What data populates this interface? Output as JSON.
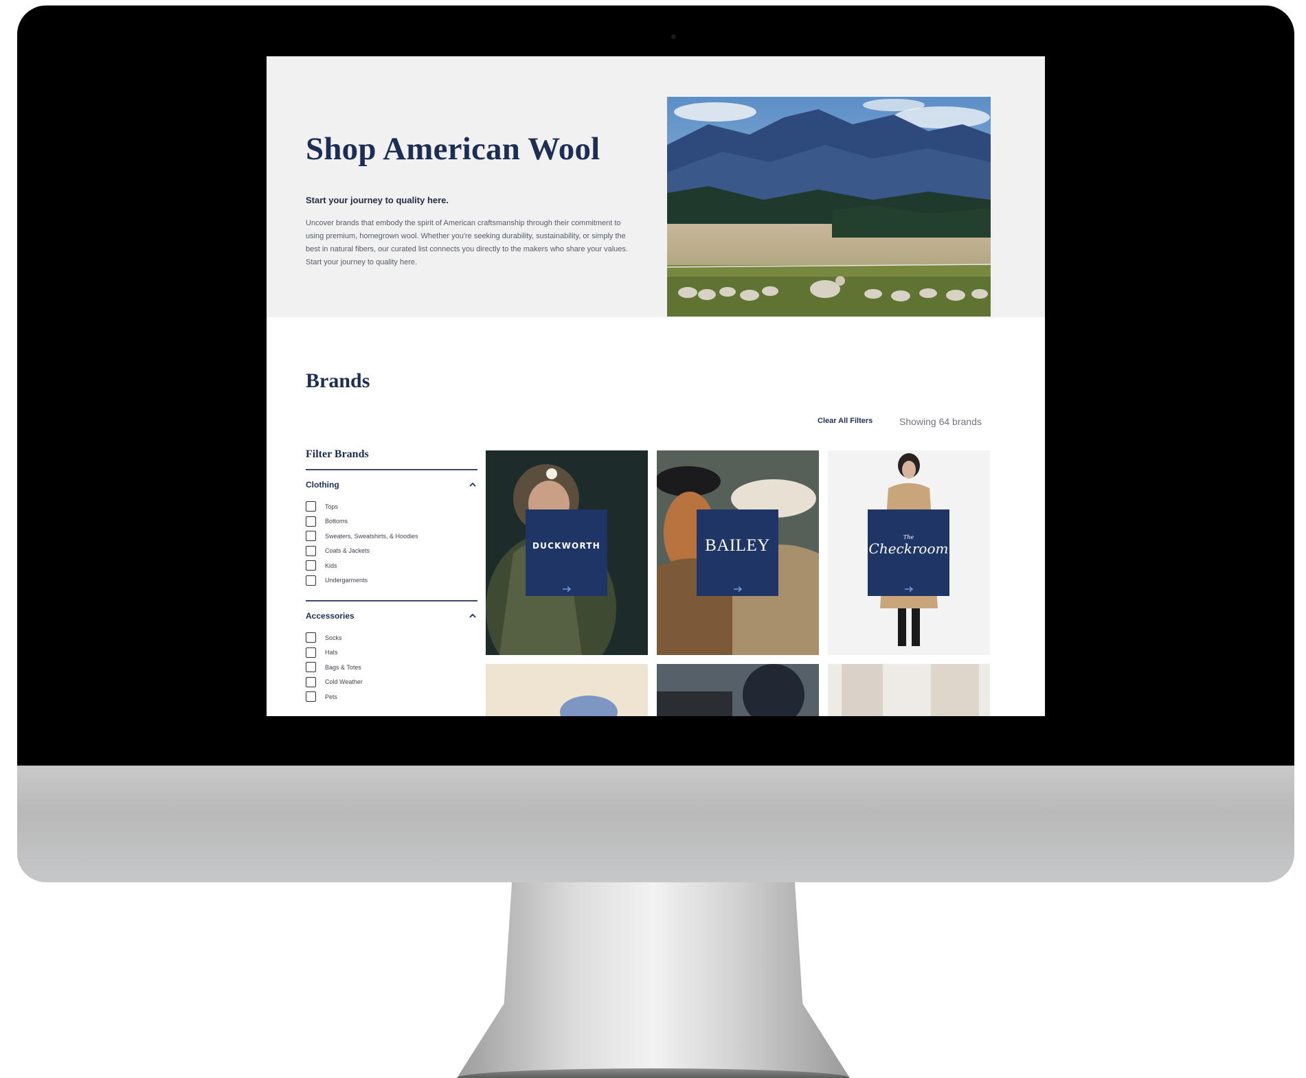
{
  "hero": {
    "title": "Shop American Wool",
    "subtitle": "Start your journey to quality here.",
    "body": "Uncover brands that embody the spirit of American craftsmanship through their commitment to using premium, homegrown wool. Whether you're seeking durability, sustainability, or simply the best in natural fibers, our curated list connects you directly to the makers who share your values. Start your journey to quality here."
  },
  "brands": {
    "heading": "Brands",
    "clear_filters_label": "Clear All Filters",
    "showing_text": "Showing 64 brands"
  },
  "filters": {
    "title": "Filter Brands",
    "groups": [
      {
        "label": "Clothing",
        "options": [
          "Tops",
          "Bottoms",
          "Sweaters, Sweatshirts, & Hoodies",
          "Coats & Jackets",
          "Kids",
          "Undergarments"
        ]
      },
      {
        "label": "Accessories",
        "options": [
          "Socks",
          "Hats",
          "Bags & Totes",
          "Cold Weather",
          "Pets"
        ]
      }
    ]
  },
  "brand_cards": [
    {
      "name": "DUCKWORTH"
    },
    {
      "name": "BAILEY"
    },
    {
      "name": "Checkroom",
      "prefix": "The"
    }
  ],
  "colors": {
    "navy": "#1d2e55",
    "logo_tile": "#1f3566",
    "hero_bg": "#f1f1f2"
  }
}
